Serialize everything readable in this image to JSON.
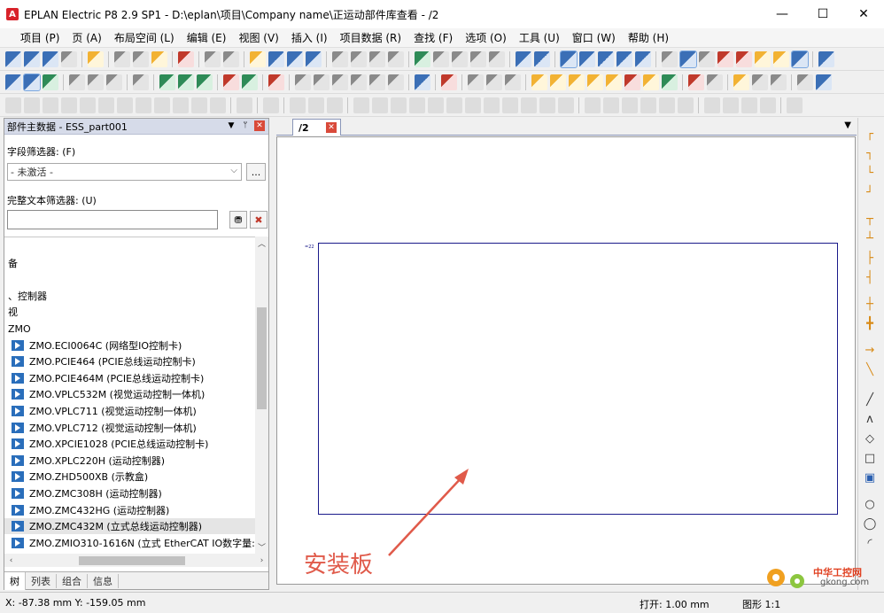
{
  "window": {
    "title": "EPLAN Electric P8 2.9 SP1 - D:\\eplan\\项目\\Company name\\正运动部件库查看 - /2",
    "logo": "A",
    "min": "—",
    "max": "☐",
    "close": "✕"
  },
  "menu": [
    "项目 (P)",
    "页 (A)",
    "布局空间 (L)",
    "编辑 (E)",
    "视图 (V)",
    "插入 (I)",
    "项目数据 (R)",
    "查找 (F)",
    "选项 (O)",
    "工具 (U)",
    "窗口 (W)",
    "帮助 (H)"
  ],
  "panel": {
    "title": "部件主数据 - ESS_part001",
    "drop": "▼",
    "pin": "ᛘ",
    "close": "✕",
    "field_filter_label": "字段筛选器: (F)",
    "field_filter_value": "- 未激活 -",
    "dots": "...",
    "text_filter_label": "完整文本筛选器: (U)",
    "text_filter_value": "",
    "search_btn": "⛃",
    "clear_btn": "✖",
    "tree": [
      {
        "text": "",
        "icon": false
      },
      {
        "text": "备",
        "icon": false
      },
      {
        "text": "",
        "icon": false
      },
      {
        "text": "、控制器",
        "icon": false
      },
      {
        "text": "视",
        "icon": false
      },
      {
        "text": "ZMO",
        "icon": false
      },
      {
        "text": "ZMO.ECI0064C (网络型IO控制卡)",
        "icon": true
      },
      {
        "text": "ZMO.PCIE464 (PCIE总线运动控制卡)",
        "icon": true
      },
      {
        "text": "ZMO.PCIE464M (PCIE总线运动控制卡)",
        "icon": true
      },
      {
        "text": "ZMO.VPLC532M (视觉运动控制一体机)",
        "icon": true
      },
      {
        "text": "ZMO.VPLC711 (视觉运动控制一体机)",
        "icon": true
      },
      {
        "text": "ZMO.VPLC712 (视觉运动控制一体机)",
        "icon": true
      },
      {
        "text": "ZMO.XPCIE1028 (PCIE总线运动控制卡)",
        "icon": true
      },
      {
        "text": "ZMO.XPLC220H (运动控制器)",
        "icon": true
      },
      {
        "text": "ZMO.ZHD500XB (示教盒)",
        "icon": true
      },
      {
        "text": "ZMO.ZMC308H (运动控制器)",
        "icon": true
      },
      {
        "text": "ZMO.ZMC432HG (运动控制器)",
        "icon": true
      },
      {
        "text": "ZMO.ZMC432M (立式总线运动控制器)",
        "icon": true,
        "selected": true
      },
      {
        "text": "ZMO.ZMIO310-1616N (立式 EtherCAT IO数字量:",
        "icon": true
      }
    ],
    "tabs": [
      "树",
      "列表",
      "组合",
      "信息"
    ]
  },
  "document": {
    "tab": "/2",
    "tab_close": "✕",
    "menu": "▼",
    "sheet_label": "=22",
    "annotation": "安装板"
  },
  "status": {
    "coords": "X: -87.38 mm   Y: -159.05 mm",
    "open": "打开: 1.00 mm",
    "shape": "图形 1:1"
  },
  "watermark": {
    "text": "中华工控网",
    "url": "gkong.com"
  }
}
